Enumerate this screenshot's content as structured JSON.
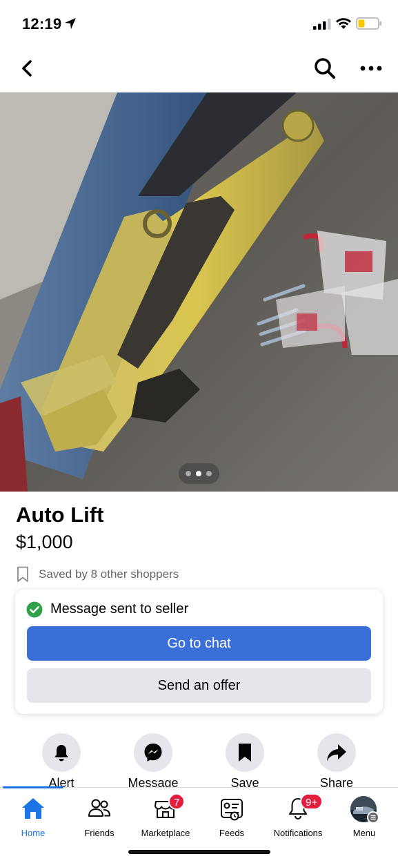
{
  "status_bar": {
    "time": "12:19"
  },
  "photo": {
    "dot_count": 3,
    "active_dot_index": 1
  },
  "listing": {
    "title": "Auto Lift",
    "price": "$1,000",
    "saved_text": "Saved by 8 other shoppers"
  },
  "message_card": {
    "status_text": "Message sent to seller",
    "go_to_chat_label": "Go to chat",
    "send_offer_label": "Send an offer"
  },
  "actions": [
    {
      "label": "Alert",
      "icon": "bell-icon"
    },
    {
      "label": "Message",
      "icon": "messenger-icon"
    },
    {
      "label": "Save",
      "icon": "bookmark-icon"
    },
    {
      "label": "Share",
      "icon": "share-icon"
    }
  ],
  "tabs": [
    {
      "label": "Home",
      "icon": "home-icon",
      "active": true
    },
    {
      "label": "Friends",
      "icon": "friends-icon"
    },
    {
      "label": "Marketplace",
      "icon": "marketplace-icon",
      "badge": "7"
    },
    {
      "label": "Feeds",
      "icon": "feeds-icon"
    },
    {
      "label": "Notifications",
      "icon": "notifications-icon",
      "badge": "9+"
    },
    {
      "label": "Menu",
      "icon": "avatar"
    }
  ],
  "colors": {
    "primary_button": "#3a6fd8",
    "secondary_button": "#e4e6eb",
    "active_tab": "#1b74e4",
    "badge": "#e41e3f",
    "success_check": "#31a24c"
  }
}
